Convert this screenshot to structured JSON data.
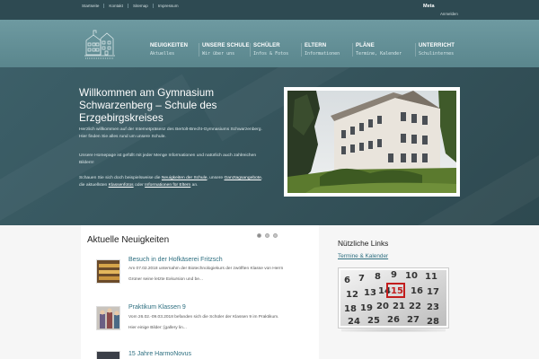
{
  "topbar": {
    "links": [
      "Startseite",
      "Kontakt",
      "Sitemap",
      "Impressum"
    ],
    "meta_title": "Meta",
    "meta_login": "Anmelden"
  },
  "nav": [
    {
      "label": "NEUIGKEITEN",
      "sub": "Aktuelles"
    },
    {
      "label": "UNSERE SCHULE",
      "sub": "Wir über uns"
    },
    {
      "label": "SCHÜLER",
      "sub": "Infos & Fotos"
    },
    {
      "label": "ELTERN",
      "sub": "Informationen"
    },
    {
      "label": "PLÄNE",
      "sub": "Termine, Kalender"
    },
    {
      "label": "UNTERRICHT",
      "sub": "Schulinternes"
    }
  ],
  "hero": {
    "title": "Willkommen am Gymnasium Schwarzenberg – Schule des Erzgebirgskreises",
    "p1": "Herzlich willkommen auf der Internetpräsenz des Bertolt-Brecht-Gymnasiums Schwarzenberg. Hier finden Sie alles rund um unsere Schule.",
    "p2": "Unsere Homepage ist gefüllt mit jeder Menge Informationen und natürlich auch zahlreichen Bildern!",
    "p3_a": "Schauen Sie sich doch beispielsweise die ",
    "p3_link1": "Neuigkeiten der Schule",
    "p3_b": ", unsere ",
    "p3_link2": "Ganztagsangebote",
    "p3_c": ", die aktuellsten ",
    "p3_link3": "Klassenfotos",
    "p3_d": " oder ",
    "p3_link4": "Informationen für Eltern",
    "p3_e": " an."
  },
  "news": {
    "title": "Aktuelle Neuigkeiten",
    "items": [
      {
        "title": "Besuch in der Hofkäserei Fritzsch",
        "line1": "Am 07.02.2018 unternahm der Biotechnologiekurs der zwölften Klasse von Herrn",
        "line2": "Grüner seine letzte Exkursion und be..."
      },
      {
        "title": "Praktikum Klassen 9",
        "line1": "Vom 26.02.-09.03.2018 befanden sich die Schüler der Klassen 9 im Praktikum.",
        "line2": "Hier einige Bilder: [gallery lin..."
      },
      {
        "title": "15 Jahre HarmoNovus",
        "line1": "",
        "line2": ""
      }
    ]
  },
  "sidebar": {
    "title": "Nützliche Links",
    "link": "Termine & Kalender",
    "calendar_numbers": [
      "6",
      "7",
      "8",
      "9",
      "10",
      "11",
      "12",
      "13",
      "14",
      "15",
      "16",
      "17",
      "18",
      "19",
      "20",
      "21",
      "22",
      "23",
      "24",
      "25",
      "26",
      "27",
      "28"
    ]
  },
  "colors": {
    "topbar": "#2e4a52",
    "header": "#6e9aa1",
    "hero": "#3a5c64",
    "link": "#2e6f80"
  }
}
